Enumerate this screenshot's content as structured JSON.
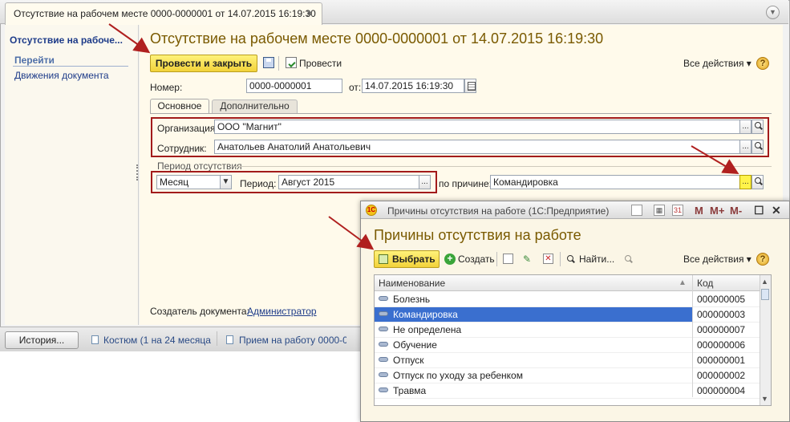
{
  "tabbar": {
    "tab_title": "Отсутствие на рабочем месте 0000-0000001 от 14.07.2015 16:19:30",
    "close_glyph": "✕"
  },
  "sidebar": {
    "active_item": "Отсутствие на рабоче...",
    "goto_label": "Перейти",
    "link": "Движения документа"
  },
  "form": {
    "title": "Отсутствие на рабочем месте 0000-0000001 от 14.07.2015 16:19:30",
    "post_close_label": "Провести и закрыть",
    "post_label": "Провести",
    "all_actions": "Все действия ▾",
    "help": "?",
    "number_label": "Номер:",
    "number_value": "0000-0000001",
    "date_label": "от:",
    "date_value": "14.07.2015 16:19:30",
    "tabs": [
      "Основное",
      "Дополнительно"
    ],
    "org_label": "Организация:",
    "org_value": "ООО \"Магнит\"",
    "employee_label": "Сотрудник:",
    "employee_value": "Анатольев Анатолий Анатольевич",
    "period_group": "Период отсутствия",
    "period_type": "Месяц",
    "period_label": "Период:",
    "period_value": "Август 2015",
    "reason_label": "по причине:",
    "reason_value": "Командировка",
    "creator_label": "Создатель документа:",
    "creator_value": "Администратор",
    "dots": "..."
  },
  "taskbar": {
    "history": "История...",
    "items": [
      "Костюм (1 на 24 месяца...",
      "Прием на работу 0000-0..."
    ]
  },
  "popup": {
    "window_title": "Причины отсутствия на работе  (1С:Предприятие)",
    "logo": "1С",
    "heading": "Причины отсутствия на работе",
    "select": "Выбрать",
    "create": "Создать",
    "find": "Найти...",
    "all_actions": "Все действия ▾",
    "help": "?",
    "m_buttons": [
      "M",
      "M+",
      "M-"
    ],
    "cal_day": "31",
    "col_name": "Наименование",
    "col_code": "Код",
    "rows": [
      {
        "name": "Болезнь",
        "code": "000000005"
      },
      {
        "name": "Командировка",
        "code": "000000003"
      },
      {
        "name": "Не определена",
        "code": "000000007"
      },
      {
        "name": "Обучение",
        "code": "000000006"
      },
      {
        "name": "Отпуск",
        "code": "000000001"
      },
      {
        "name": "Отпуск по уходу за ребенком",
        "code": "000000002"
      },
      {
        "name": "Травма",
        "code": "000000004"
      }
    ]
  },
  "colors": {
    "accent_title": "#7a5a00",
    "highlight_box": "#a21b1b",
    "selection": "#3a6fcf"
  }
}
